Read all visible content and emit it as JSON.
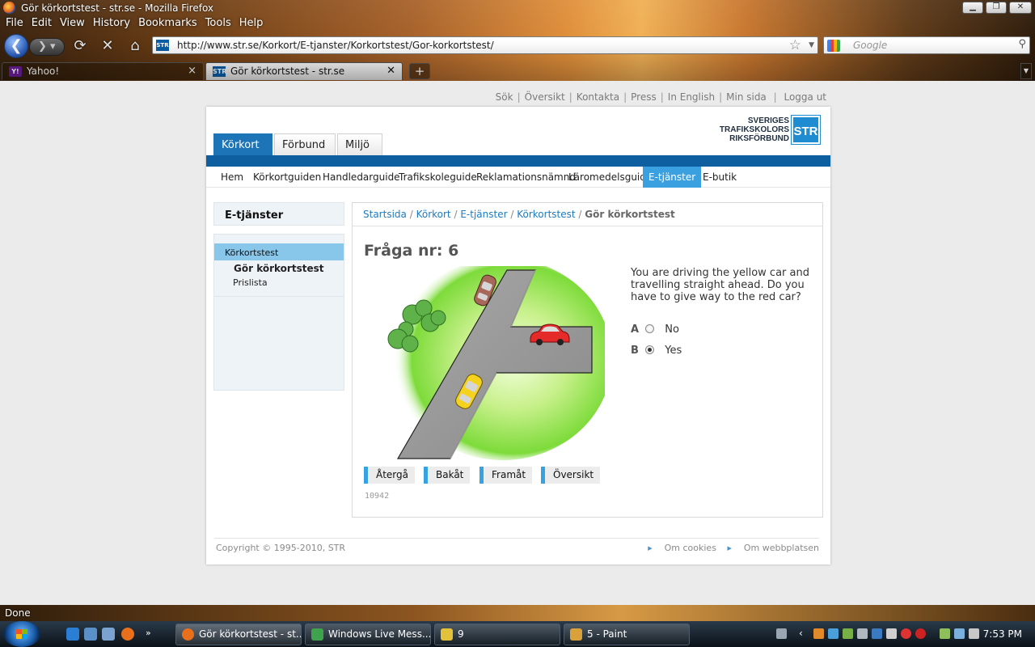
{
  "window": {
    "title": "Gör körkortstest - str.se - Mozilla Firefox",
    "minimize": "▁",
    "maximize": "❐",
    "close": "✕"
  },
  "menubar": [
    "File",
    "Edit",
    "View",
    "History",
    "Bookmarks",
    "Tools",
    "Help"
  ],
  "navbar": {
    "url": "http://www.str.se/Korkort/E-tjanster/Korkortstest/Gor-korkortstest/",
    "site_icon": "STR",
    "search_placeholder": "Google"
  },
  "tabs": [
    {
      "label": "Yahoo!",
      "favicon": "Y!",
      "active": false
    },
    {
      "label": "Gör körkortstest - str.se",
      "favicon": "STR",
      "active": true
    }
  ],
  "page": {
    "util_links": [
      "Sök",
      "Översikt",
      "Kontakta",
      "Press",
      "In English",
      "Min sida",
      "Logga ut"
    ],
    "logo": {
      "line1": "SVERIGES",
      "line2": "TRAFIKSKOLORS",
      "line3": "RIKSFÖRBUND",
      "mark": "STR"
    },
    "main_tabs": [
      "Körkort",
      "Förbund",
      "Miljö"
    ],
    "sub_nav": [
      "Hem",
      "Körkortguiden",
      "Handledarguide",
      "Trafikskoleguide",
      "Reklamationsnämnd",
      "Läromedelsguide",
      "E-tjänster",
      "E-butik"
    ],
    "sub_nav_active": "E-tjänster",
    "left_panel": {
      "heading": "E-tjänster",
      "items": [
        "Körkortstest",
        "Gör körkortstest",
        "Prislista"
      ]
    },
    "breadcrumb": {
      "links": [
        "Startsida",
        "Körkort",
        "E-tjänster",
        "Körkortstest"
      ],
      "current": "Gör körkortstest",
      "separator": "/"
    },
    "question": {
      "title": "Fråga nr: 6",
      "text": "You are driving the yellow car and travelling straight ahead. Do you have to give way to the red car?",
      "answers": [
        {
          "letter": "A",
          "label": "No",
          "selected": false
        },
        {
          "letter": "B",
          "label": "Yes",
          "selected": true
        }
      ],
      "buttons": [
        "Återgå",
        "Bakåt",
        "Framåt",
        "Översikt"
      ],
      "id": "10942"
    },
    "footer": {
      "copyright": "Copyright © 1995-2010, STR",
      "links": [
        "Om cookies",
        "Om webbplatsen"
      ]
    }
  },
  "statusbar": {
    "text": "Done"
  },
  "taskbar": {
    "buttons": [
      {
        "label": "Gör körkortstest - st...",
        "color": "#e8701a",
        "active": true
      },
      {
        "label": "Windows Live Mess...",
        "color": "#3fa34d",
        "active": false
      },
      {
        "label": "9",
        "color": "#e3c23b",
        "active": false
      },
      {
        "label": "5 - Paint",
        "color": "#d9a13a",
        "active": false
      }
    ],
    "clock": "7:53 PM"
  },
  "colors": {
    "brand_blue": "#1d74b6",
    "nav_active": "#3aa0e0",
    "left_active": "#88c7ea",
    "link": "#1b7bc0"
  }
}
